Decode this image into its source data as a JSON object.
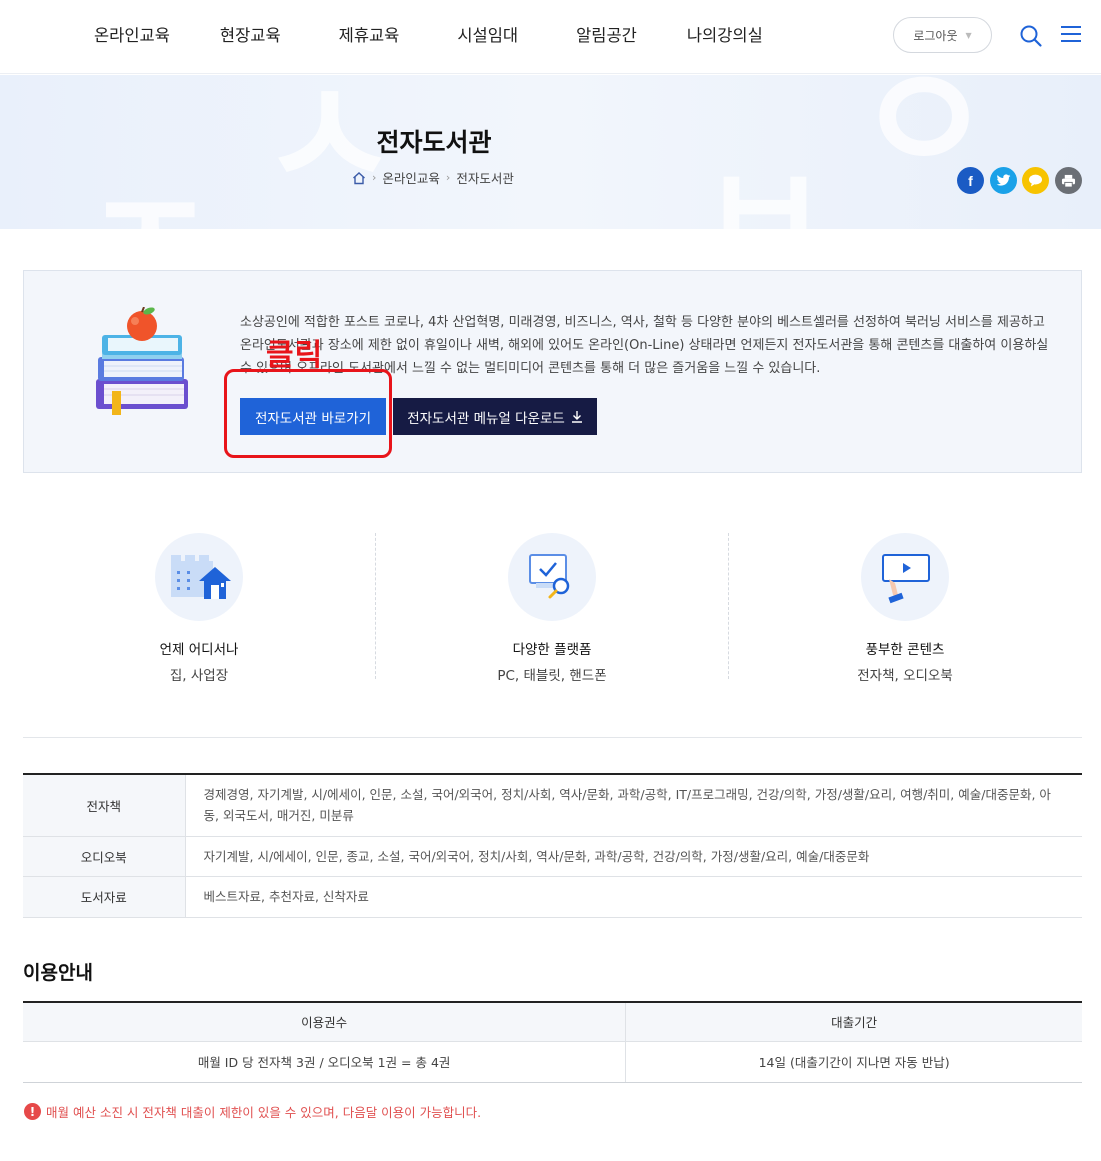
{
  "nav": {
    "items": [
      "온라인교육",
      "현장교육",
      "제휴교육",
      "시설임대",
      "알림공간",
      "나의강의실"
    ],
    "logout_label": "로그아웃"
  },
  "visual": {
    "title": "전자도서관",
    "breadcrumb": [
      "온라인교육",
      "전자도서관"
    ],
    "bg_letters": [
      "ㅈ",
      "ㅅ",
      "ㅂ",
      "ㅇ"
    ],
    "share_colors": {
      "facebook": "#1a5bc4",
      "twitter": "#1aa1e8",
      "kakao": "#f7c300",
      "print": "#6b6f75"
    }
  },
  "intro": {
    "description": "소상공인에 적합한 포스트 코로나, 4차 산업혁명, 미래경영, 비즈니스, 역사, 철학 등 다양한 분야의 베스트셀러를 선정하여 북러닝 서비스를 제공하고 온라인도서관과 장소에 제한 없이 휴일이나 새벽, 해외에 있어도 온라인(On-Line) 상태라면 언제든지 전자도서관을 통해 콘텐츠를 대출하여 이용하실 수 있으며 오프라인 도서관에서 느낄 수 없는 멀티미디어 콘텐츠를 통해 더 많은 즐거움을 느낄 수 있습니다.",
    "primary_button": "전자도서관 바로가기",
    "manual_button": "전자도서관 메뉴얼 다운로드"
  },
  "annotation": {
    "label": "클릭",
    "color": "#e8141a"
  },
  "features": [
    {
      "title": "언제 어디서나",
      "sub": "집, 사업장"
    },
    {
      "title": "다양한 플랫폼",
      "sub": "PC, 태블릿, 핸드폰"
    },
    {
      "title": "풍부한 콘텐츠",
      "sub": "전자책, 오디오북"
    }
  ],
  "categories": [
    {
      "label": "전자책",
      "value": "경제경영, 자기계발, 시/에세이, 인문, 소설, 국어/외국어, 정치/사회, 역사/문화, 과학/공학, IT/프로그래밍, 건강/의학, 가정/생활/요리, 여행/취미, 예술/대중문화, 아동, 외국도서, 매거진, 미분류"
    },
    {
      "label": "오디오북",
      "value": "자기계발, 시/에세이, 인문, 종교, 소설, 국어/외국어, 정치/사회, 역사/문화, 과학/공학, 건강/의학, 가정/생활/요리, 예술/대중문화"
    },
    {
      "label": "도서자료",
      "value": "베스트자료, 추천자료, 신착자료"
    }
  ],
  "usage": {
    "section_title": "이용안내",
    "headers": [
      "이용권수",
      "대출기간"
    ],
    "row": [
      "매월 ID 당 전자책 3권 / 오디오북 1권 = 총 4권",
      "14일 (대출기간이 지나면 자동 반납)"
    ]
  },
  "notice": "매월 예산 소진 시 전자책 대출이 제한이 있을 수 있으며, 다음달 이용이 가능합니다."
}
